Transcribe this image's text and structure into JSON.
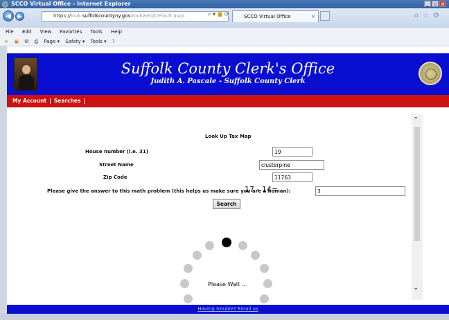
{
  "browser": {
    "window_title": "SCCO Virtual Office - Internet Explorer",
    "url_prefix": "https://",
    "url_faded_start": "look.",
    "url_host": "suffolkcountyny.gov",
    "url_path": "/lookweb/Default.aspx",
    "tab_title": "SCCO Virtual Office",
    "tab_close": "×",
    "menu": [
      "File",
      "Edit",
      "View",
      "Favorites",
      "Tools",
      "Help"
    ],
    "commands": [
      "Page ▾",
      "Safety ▾",
      "Tools ▾"
    ]
  },
  "banner": {
    "title": "Suffolk County Clerk's Office",
    "subtitle": "Judith A. Pascale - Suffolk County Clerk"
  },
  "nav": {
    "my_account": "My Account",
    "searches": "Searches",
    "separator": "|"
  },
  "form": {
    "title": "Look Up Tax Map",
    "house_label": "House number (i.e. 31)",
    "house_value": "19",
    "street_label": "Street Name",
    "street_value": "clusterpine",
    "zip_label": "Zip Code",
    "zip_value": "11763",
    "math_label": "Please give the answer to this math problem (this helps us make sure you are a human):",
    "math_question": "17 - 14=",
    "math_value": "3",
    "search_button": "Search"
  },
  "loading": {
    "text": "Please Wait ..."
  },
  "footer": {
    "link": "Having trouble? Email us"
  }
}
